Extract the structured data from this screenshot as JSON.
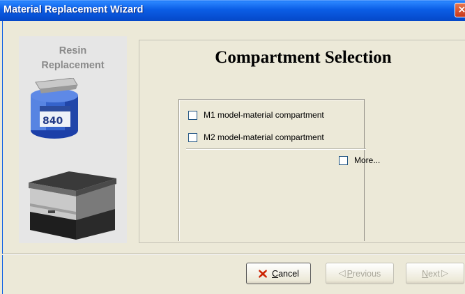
{
  "window": {
    "title": "Material Replacement Wizard",
    "close_glyph": "×"
  },
  "left_panel": {
    "title_line1": "Resin",
    "title_line2": "Replacement",
    "icon1": "resin-cartridge-icon",
    "icon2": "printer-icon",
    "cartridge_label": "840"
  },
  "main": {
    "title": "Compartment Selection",
    "options": [
      {
        "label": "M1 model-material compartment",
        "checked": false
      },
      {
        "label": "M2 model-material compartment",
        "checked": false
      }
    ],
    "more_label": "More...",
    "more_checked": false
  },
  "buttons": {
    "cancel_key": "C",
    "cancel_rest": "ancel",
    "previous_key": "P",
    "previous_rest": "revious",
    "next_key": "N",
    "next_rest": "ext"
  },
  "colors": {
    "titlebar": "#0b5ee6",
    "face": "#ece9d8",
    "cancel_x": "#cc2200"
  }
}
